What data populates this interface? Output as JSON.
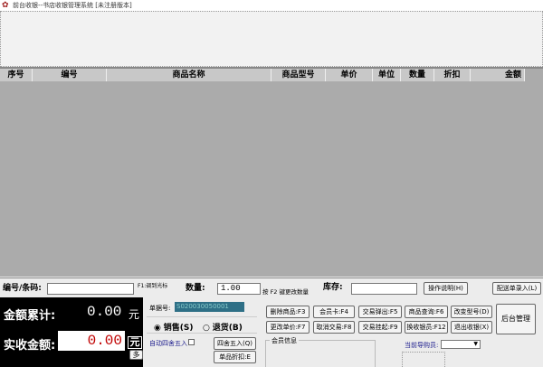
{
  "window": {
    "title": "前台收银--书店收银管理系统 [未注册版本]",
    "icon": "app-logo-icon"
  },
  "table": {
    "columns": [
      "序号",
      "编号",
      "商品名称",
      "商品型号",
      "单价",
      "单位",
      "数量",
      "折扣",
      "金额"
    ]
  },
  "entry": {
    "code_label": "编号/条码:",
    "code_value": "",
    "f1_hint": "F1:调到光标",
    "qty_label": "数量:",
    "qty_value": "1.00",
    "f2_hint": "按 F2 键更改数量",
    "stock_label": "库存:",
    "stock_value": "",
    "help_button": "操作说明(H)",
    "delivery_button": "配送单录入(L)"
  },
  "totals": {
    "sum_label": "金额累计:",
    "sum_value": "0.00",
    "currency": "元",
    "paid_label": "实收金额:",
    "paid_value": "0.00",
    "paid_currency": "元",
    "multi_button": "多"
  },
  "order": {
    "no_label": "单据号:",
    "no_value": "S020030050001",
    "sale_label": "销售(S)",
    "return_label": "退货(B)",
    "selected": "sale",
    "auto_round_label": "自动四舍五入",
    "round_button": "四舍五入(Q)",
    "discount_button": "单品折扣:E"
  },
  "actions": {
    "row1": [
      "删除商品:F3",
      "会员卡:F4",
      "交易弹出:F5",
      "商品查询:F6",
      "改变型号(D)"
    ],
    "row2": [
      "更改单价:F7",
      "取消交易:F8",
      "交易挂起:F9",
      "换收银员:F12",
      "退出收银(X)"
    ],
    "admin": "后台管理"
  },
  "member": {
    "label": "会员信息"
  },
  "guide": {
    "label": "当前导购员:",
    "value": ""
  },
  "colors": {
    "grid": "#ababab",
    "teal": "#2e6f86",
    "red": "#c00000"
  }
}
